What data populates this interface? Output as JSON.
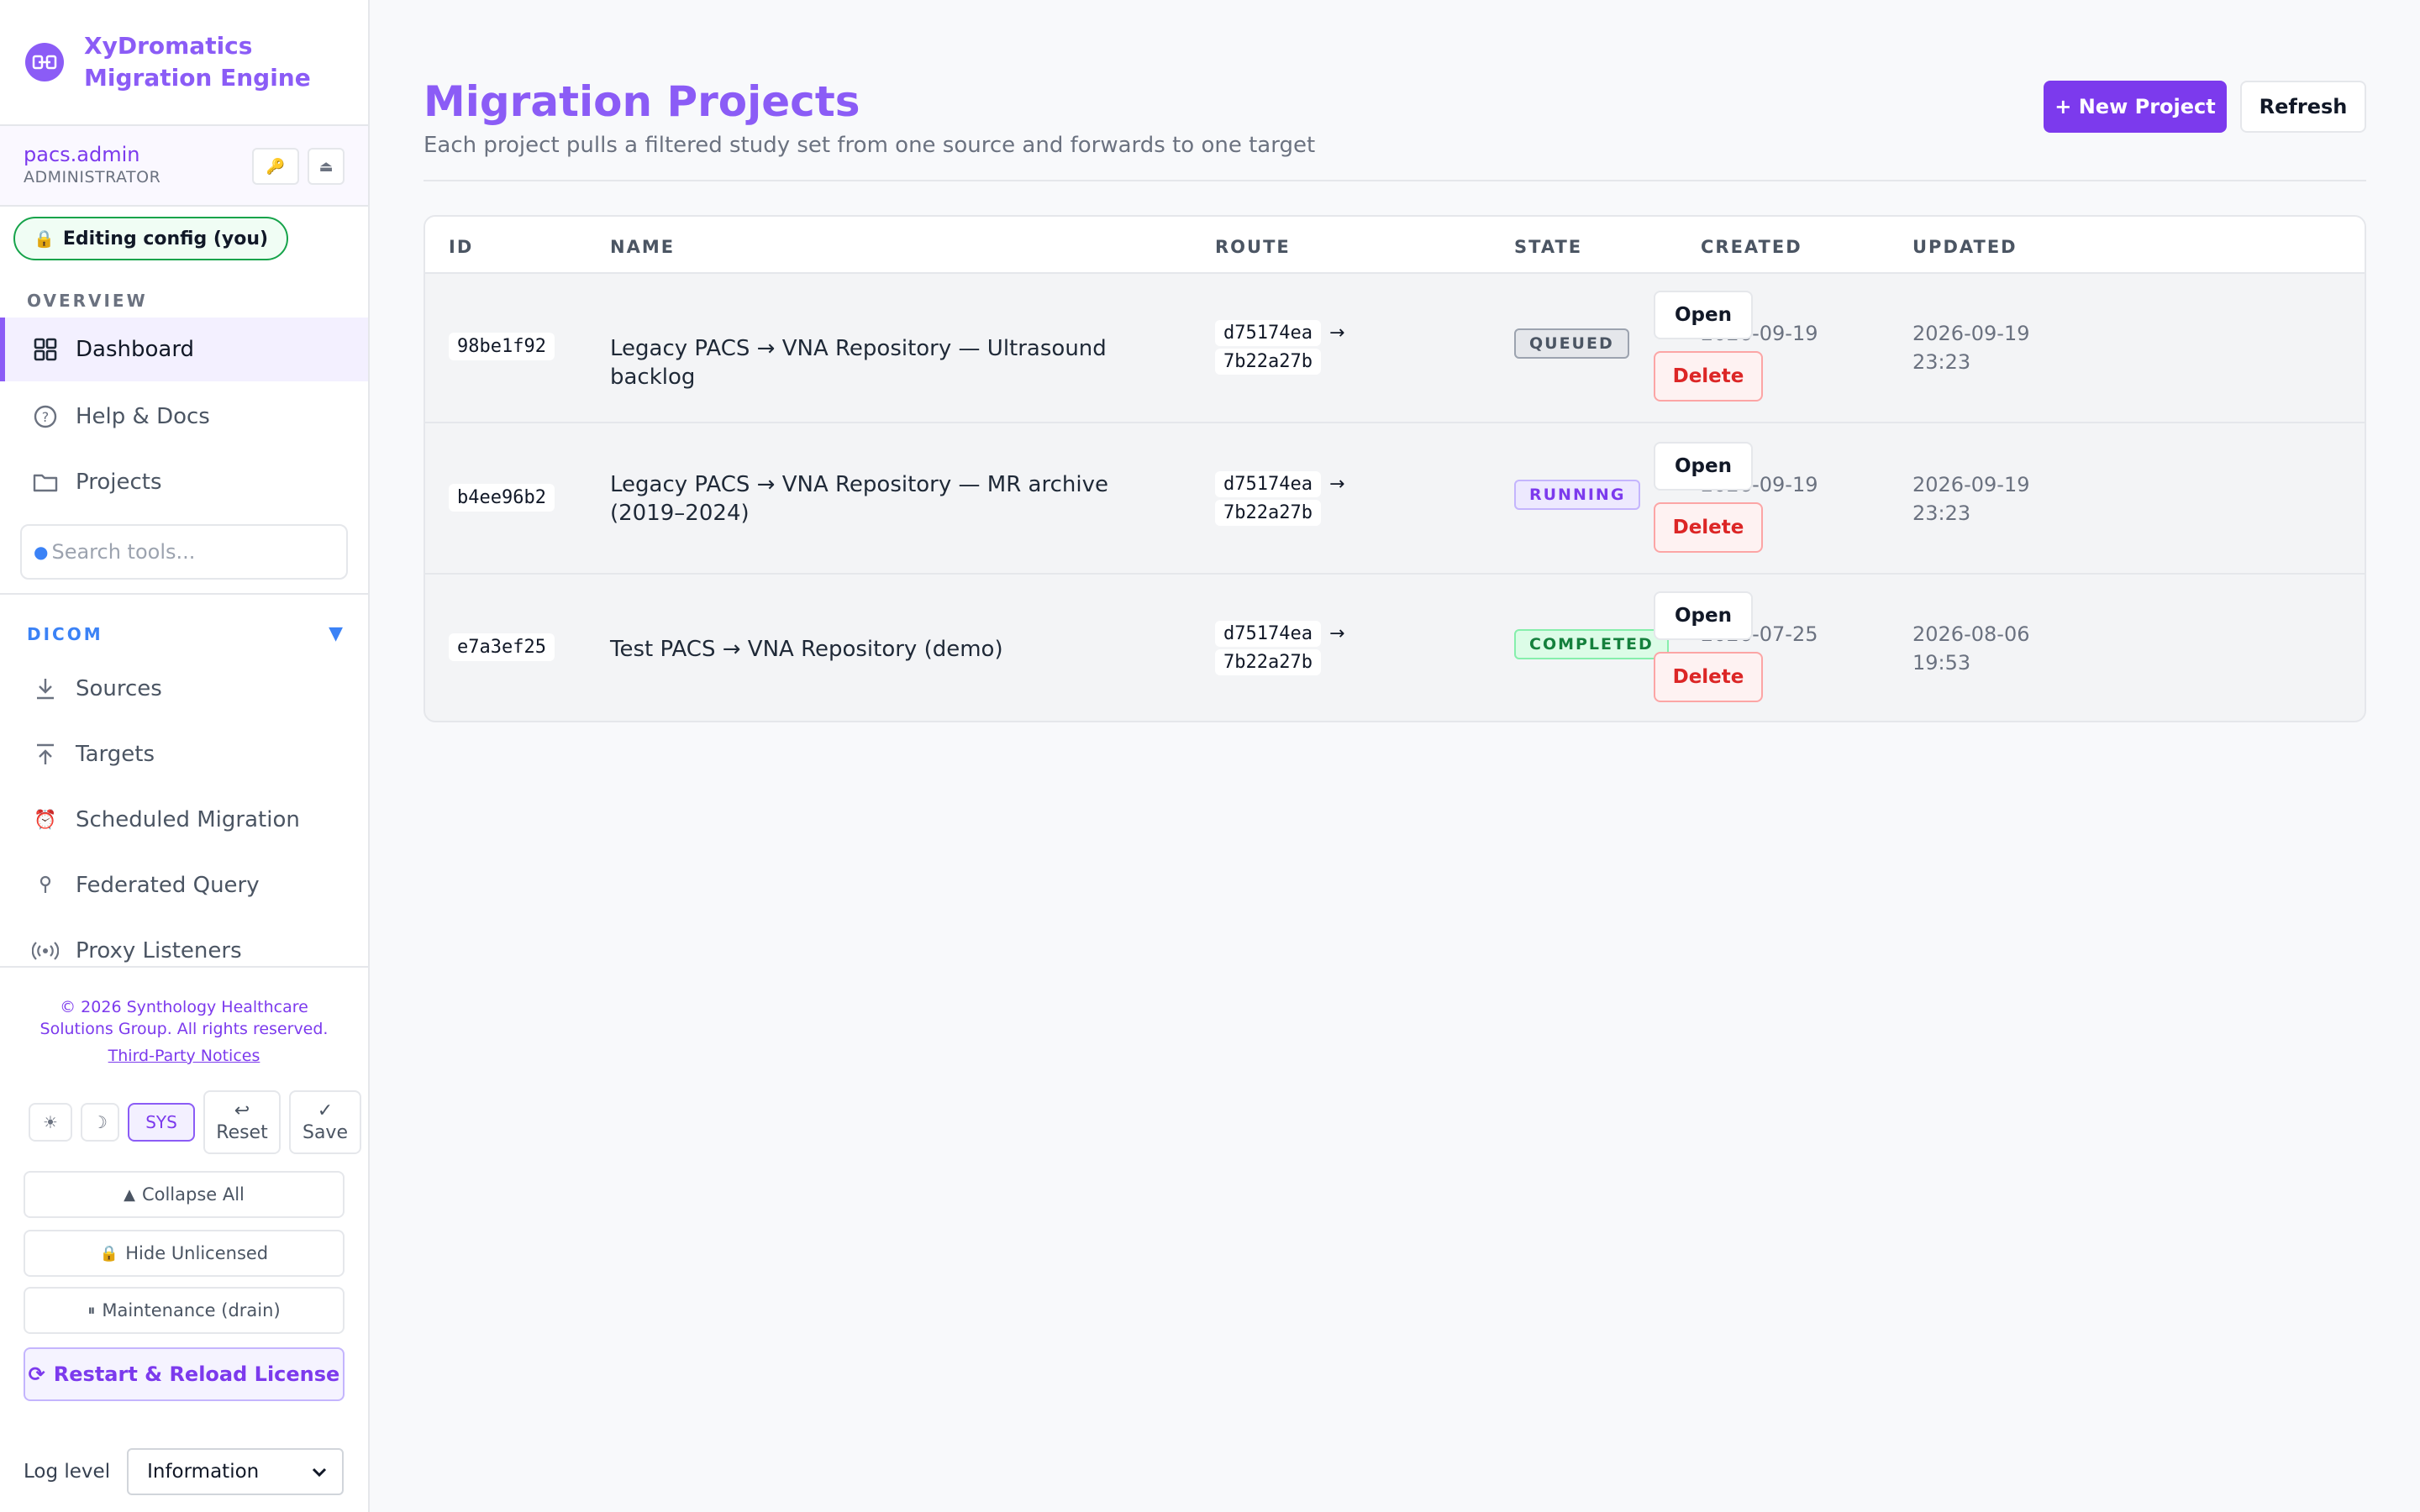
{
  "app": {
    "title_line1": "XyDromatics",
    "title_line2": "Migration Engine",
    "logo_icon": "link-chain-icon"
  },
  "user": {
    "name": "pacs.admin",
    "role": "ADMINISTRATOR",
    "key_icon": "key-icon",
    "eject_icon": "eject-icon"
  },
  "editing_pill": "Editing config (you)",
  "sidebar": {
    "overview_label": "OVERVIEW",
    "overview_items": [
      {
        "label": "Dashboard",
        "icon": "grid-icon",
        "active": true
      },
      {
        "label": "Help & Docs",
        "icon": "help-circle-icon",
        "active": false
      },
      {
        "label": "Projects",
        "icon": "folder-icon",
        "active": false
      }
    ],
    "search_placeholder": "Search tools...",
    "dicom_label": "DICOM",
    "dicom_items": [
      {
        "label": "Sources",
        "icon": "download-icon"
      },
      {
        "label": "Targets",
        "icon": "upload-icon"
      },
      {
        "label": "Scheduled Migration",
        "icon": "alarm-clock-icon"
      },
      {
        "label": "Federated Query",
        "icon": "pin-icon"
      },
      {
        "label": "Proxy Listeners",
        "icon": "broadcast-icon"
      }
    ]
  },
  "footer": {
    "copyright": "© 2026 Synthology Healthcare Solutions Group. All rights reserved.",
    "third_party": "Third-Party Notices",
    "theme_light": "☀",
    "theme_dark": "☽",
    "theme_sys": "SYS",
    "reset_label": "Reset",
    "save_label": "Save",
    "collapse_all": "Collapse All",
    "hide_unlicensed": "Hide Unlicensed",
    "maintenance": "Maintenance (drain)",
    "restart": "Restart & Reload License",
    "log_level_label": "Log level",
    "log_level_value": "Information"
  },
  "main": {
    "title": "Migration Projects",
    "subtitle": "Each project pulls a filtered study set from one source and forwards to one target",
    "new_project": "+ New Project",
    "refresh": "Refresh",
    "columns": [
      "ID",
      "NAME",
      "ROUTE",
      "STATE",
      "CREATED",
      "UPDATED"
    ],
    "rows": [
      {
        "id": "98be1f92",
        "name": "Legacy PACS → VNA Repository — Ultrasound backlog",
        "route_from": "d75174ea",
        "route_to": "7b22a27b",
        "state": "QUEUED",
        "created": "2026-09-19 23:22",
        "updated": "2026-09-19 23:23",
        "open": "Open",
        "delete": "Delete"
      },
      {
        "id": "b4ee96b2",
        "name": "Legacy PACS → VNA Repository — MR archive (2019–2024)",
        "route_from": "d75174ea",
        "route_to": "7b22a27b",
        "state": "RUNNING",
        "created": "2026-09-19 23:22",
        "updated": "2026-09-19 23:23",
        "open": "Open",
        "delete": "Delete"
      },
      {
        "id": "e7a3ef25",
        "name": "Test PACS → VNA Repository (demo)",
        "route_from": "d75174ea",
        "route_to": "7b22a27b",
        "state": "COMPLETED",
        "created": "2026-07-25 12:11",
        "updated": "2026-08-06 19:53",
        "open": "Open",
        "delete": "Delete"
      }
    ]
  },
  "colors": {
    "accent": "#8b5cf6",
    "accent_dark": "#7c3aed",
    "danger": "#dc2626",
    "success": "#16a34a"
  }
}
